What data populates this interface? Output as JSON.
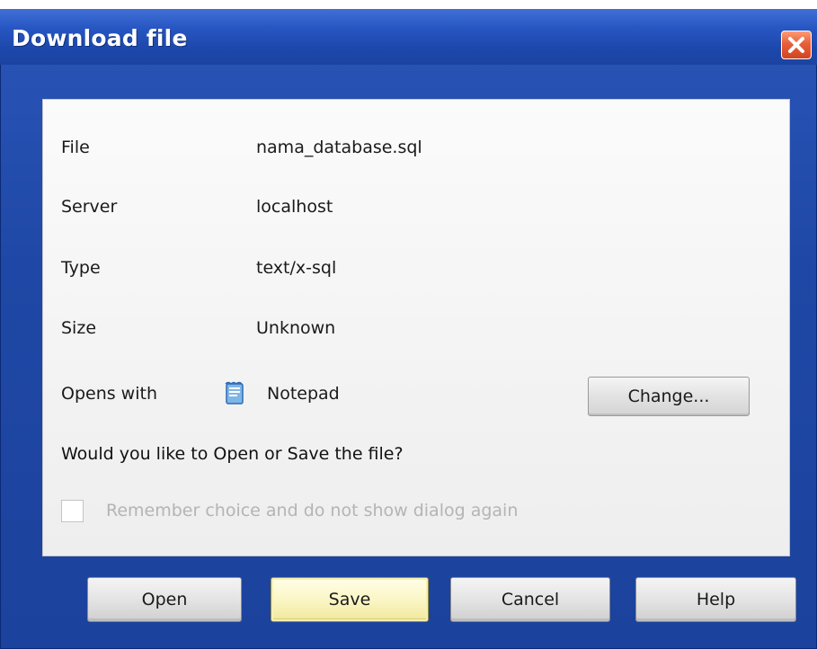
{
  "dialog": {
    "title": "Download file",
    "close_icon": "close-x-icon"
  },
  "file_info": {
    "file_label": "File",
    "file_value": "nama_database.sql",
    "server_label": "Server",
    "server_value": "localhost",
    "type_label": "Type",
    "type_value": "text/x-sql",
    "size_label": "Size",
    "size_value": "Unknown",
    "opens_with_label": "Opens with",
    "opens_with_value": "Notepad",
    "opens_with_icon": "notepad-icon",
    "change_label": "Change..."
  },
  "prompt": {
    "question": "Would you like to Open or Save the file?",
    "remember_label": "Remember choice and do not show dialog again",
    "remember_checked": false
  },
  "buttons": {
    "open": "Open",
    "save": "Save",
    "cancel": "Cancel",
    "help": "Help"
  },
  "colors": {
    "titlebar": "#1d48ac",
    "default_button": "#fbf6c6",
    "close_button": "#e7603a"
  }
}
